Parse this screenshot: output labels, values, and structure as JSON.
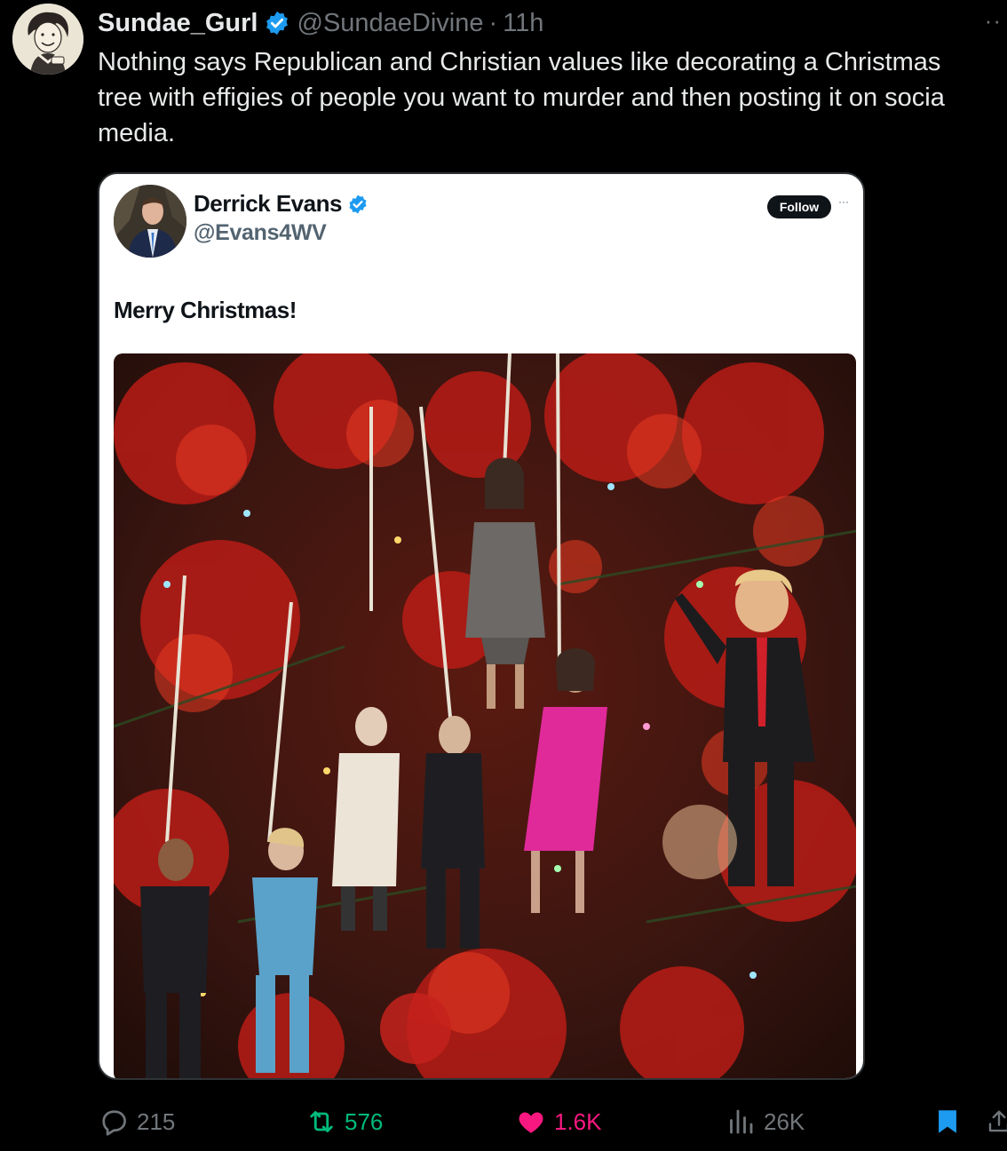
{
  "post": {
    "display_name": "Sundae_Gurl",
    "handle": "@SundaeDivine",
    "separator": "·",
    "time": "11h",
    "more": "··",
    "text": "Nothing says Republican and Christian values like decorating a Christmas\ntree with effigies of people you want to murder and then posting it on socia\nmedia."
  },
  "quoted": {
    "display_name": "Derrick Evans",
    "handle": "@Evans4WV",
    "follow_label": "Follow",
    "more": "···",
    "text": "Merry Christmas!"
  },
  "actions": {
    "replies": "215",
    "reposts": "576",
    "likes": "1.6K",
    "views": "26K"
  },
  "colors": {
    "background": "#000000",
    "verified": "#1d9bf0",
    "repost_active": "#00ba7c",
    "like_active": "#f91880",
    "bookmark_active": "#1d9bf0",
    "muted": "#71767b"
  },
  "icons": {
    "reply": "reply-icon",
    "repost": "repost-icon",
    "like": "heart-icon",
    "views": "views-icon",
    "bookmark": "bookmark-icon",
    "share": "share-icon",
    "verified": "verified-badge-icon"
  }
}
